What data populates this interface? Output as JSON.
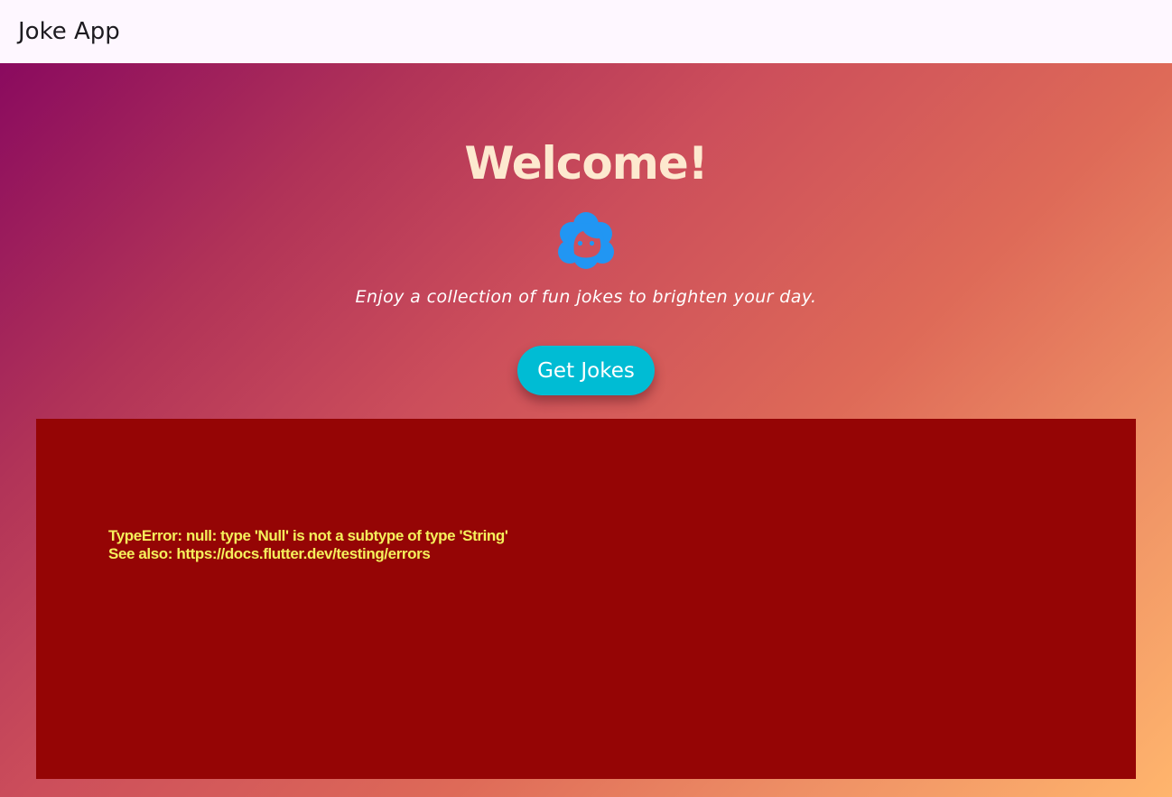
{
  "app_bar": {
    "title": "Joke App",
    "background": "#fef7ff"
  },
  "main": {
    "welcome": "Welcome!",
    "icon": "face-icon",
    "tagline": "Enjoy a collection of fun jokes to brighten your day.",
    "button_label": "Get Jokes",
    "colors": {
      "welcome_text": "#fde9cf",
      "icon": "#2196f3",
      "button": "#00bcd4",
      "gradient_start": "#8a0a5f",
      "gradient_end": "#ffb56d"
    }
  },
  "error": {
    "line1": "TypeError: null: type 'Null' is not a subtype of type 'String'",
    "line2": "See also: https://docs.flutter.dev/testing/errors",
    "background": "#950505",
    "text_color": "#f5f05b"
  }
}
